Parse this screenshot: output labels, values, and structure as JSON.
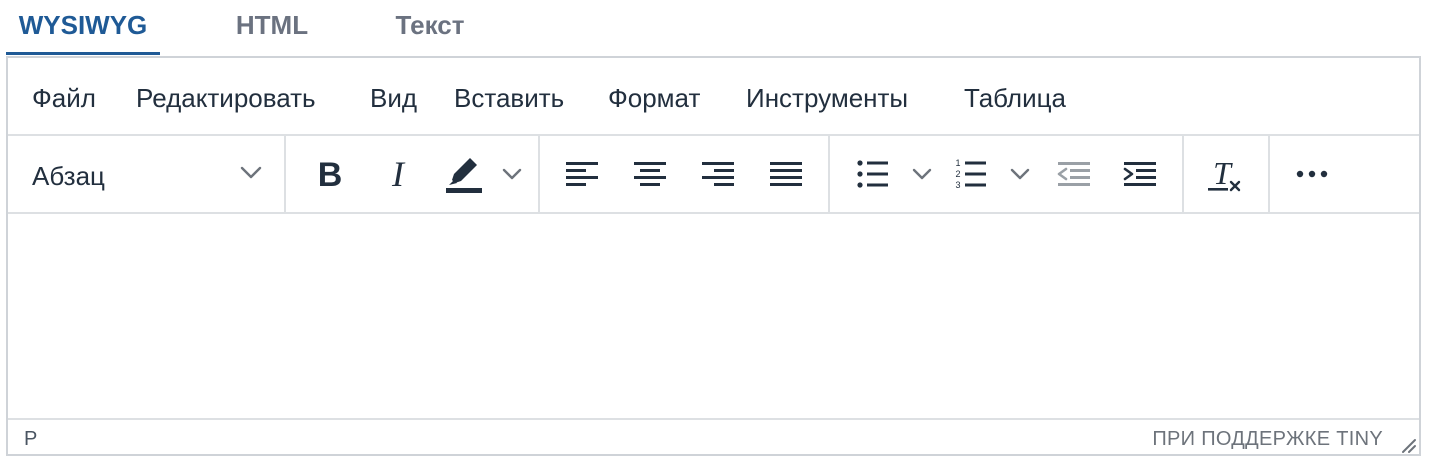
{
  "tabs": [
    {
      "label": "WYSIWYG",
      "active": true
    },
    {
      "label": "HTML",
      "active": false
    },
    {
      "label": "Текст",
      "active": false
    }
  ],
  "menubar": {
    "items": [
      "Файл",
      "Редактировать",
      "Вид",
      "Вставить",
      "Формат",
      "Инструменты",
      "Таблица"
    ]
  },
  "toolbar": {
    "block_format": "Абзац",
    "buttons": [
      {
        "name": "bold-icon"
      },
      {
        "name": "italic-icon"
      },
      {
        "name": "highlight-color-icon"
      },
      {
        "name": "align-left-icon"
      },
      {
        "name": "align-center-icon"
      },
      {
        "name": "align-right-icon"
      },
      {
        "name": "align-justify-icon"
      },
      {
        "name": "bullet-list-icon"
      },
      {
        "name": "numbered-list-icon"
      },
      {
        "name": "outdent-icon"
      },
      {
        "name": "indent-icon"
      },
      {
        "name": "clear-formatting-icon"
      },
      {
        "name": "more-icon"
      }
    ]
  },
  "statusbar": {
    "path": "P",
    "brand": "ПРИ ПОДДЕРЖКЕ TINY"
  },
  "colors": {
    "accent": "#1f5a96",
    "text": "#222f3e",
    "border": "#cfd3d8",
    "muted": "#6b7280"
  }
}
